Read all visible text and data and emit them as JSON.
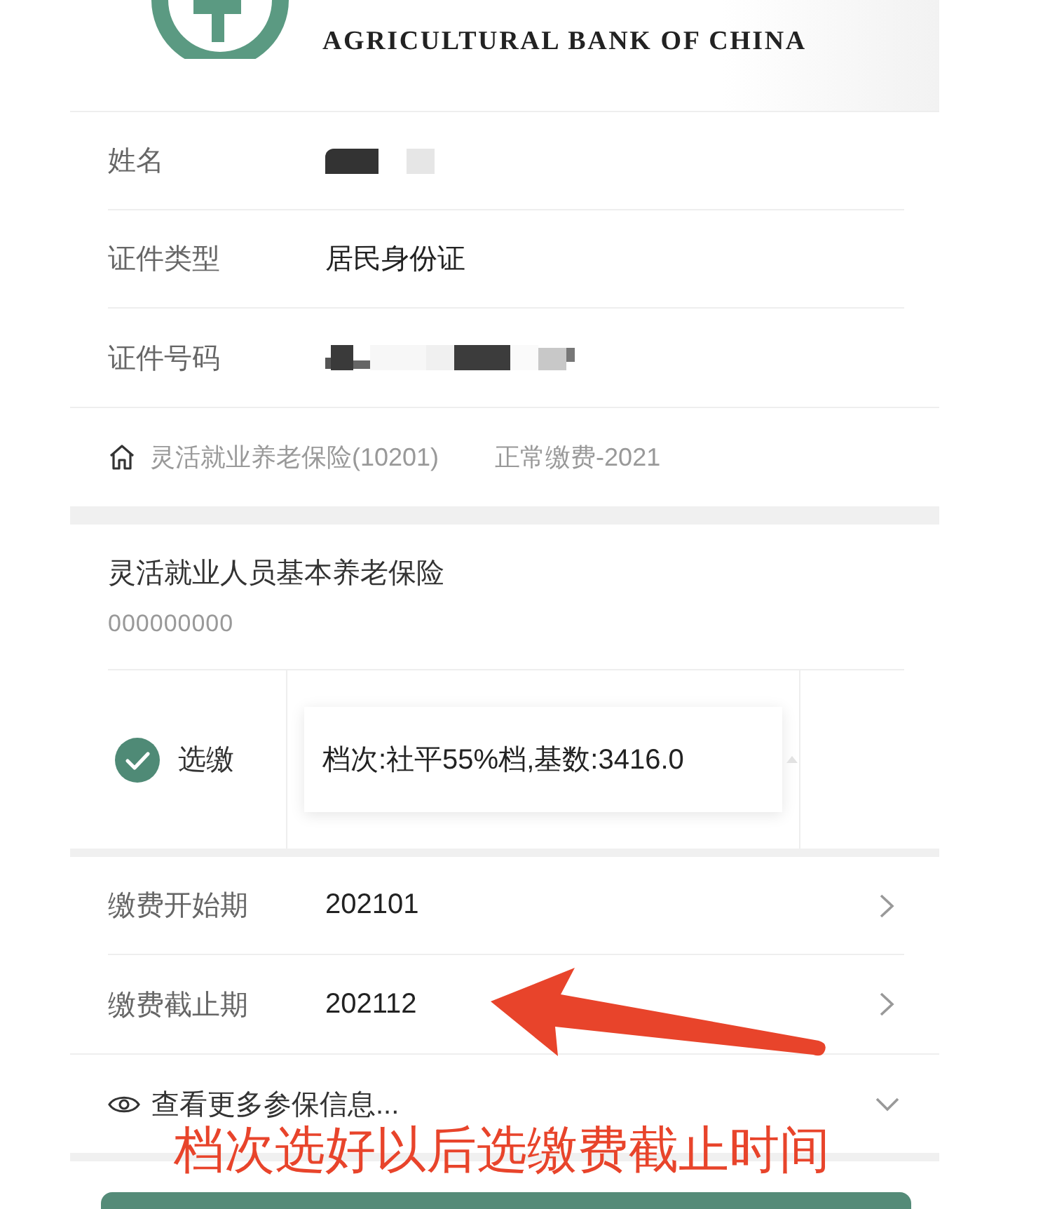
{
  "header": {
    "bank_name_en": "AGRICULTURAL BANK OF CHINA"
  },
  "identity": [
    {
      "label": "姓名",
      "kind": "redacted"
    },
    {
      "label": "证件类型",
      "kind": "text",
      "value": "居民身份证"
    },
    {
      "label": "证件号码",
      "kind": "redacted"
    }
  ],
  "plan": {
    "name": "灵活就业养老保险(10201)",
    "type": "正常缴费-2021"
  },
  "insurance": {
    "title": "灵活就业人员基本养老保险",
    "code": "000000000",
    "option": {
      "label": "选缴",
      "checked": true,
      "grade": "档次:社平55%档,基数:3416.0"
    }
  },
  "periods": [
    {
      "label": "缴费开始期",
      "value": "202101"
    },
    {
      "label": "缴费截止期",
      "value": "202112"
    }
  ],
  "more": {
    "label": "查看更多参保信息...",
    "expanded": false
  },
  "annotation": {
    "text": "档次选好以后选缴费截止时间"
  }
}
